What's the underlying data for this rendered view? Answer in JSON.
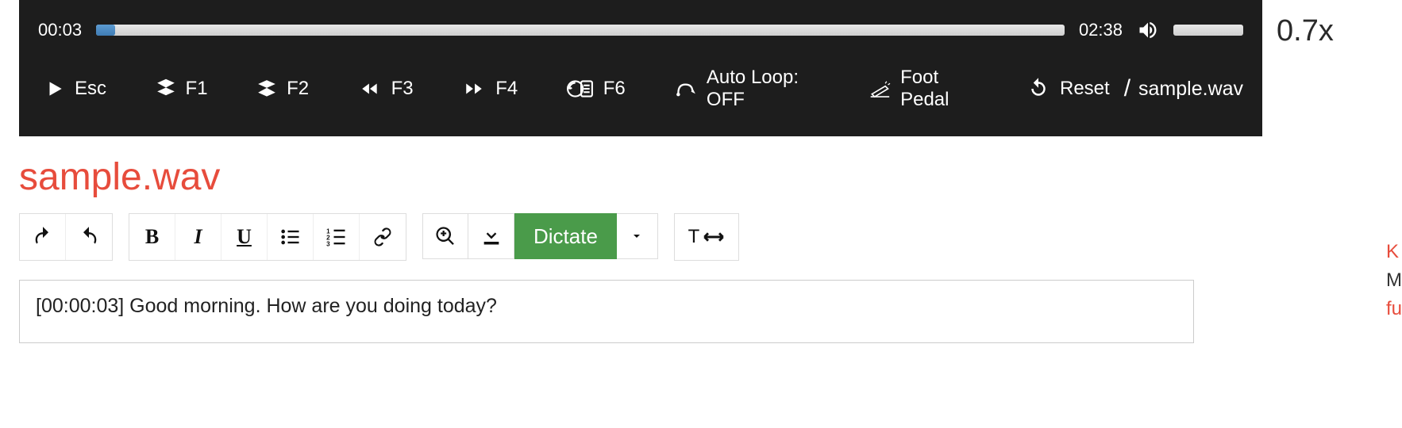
{
  "player": {
    "current_time": "00:03",
    "total_time": "02:38",
    "progress_percent": 2,
    "volume_percent": 100,
    "speed": "0.7x",
    "controls": {
      "play_key": "Esc",
      "slow_key": "F1",
      "fast_key": "F2",
      "rewind_key": "F3",
      "forward_key": "F4",
      "timestamp_key": "F6",
      "autoloop_label": "Auto Loop: OFF",
      "footpedal_label": "Foot Pedal",
      "reset_label": "Reset"
    },
    "file_label": "sample.wav"
  },
  "title": "sample.wav",
  "toolbar": {
    "dictate_label": "Dictate"
  },
  "editor": {
    "content": "[00:00:03] Good morning. How are you doing today?"
  },
  "side": {
    "line1": "K",
    "line2": "M",
    "line3": "fu"
  }
}
